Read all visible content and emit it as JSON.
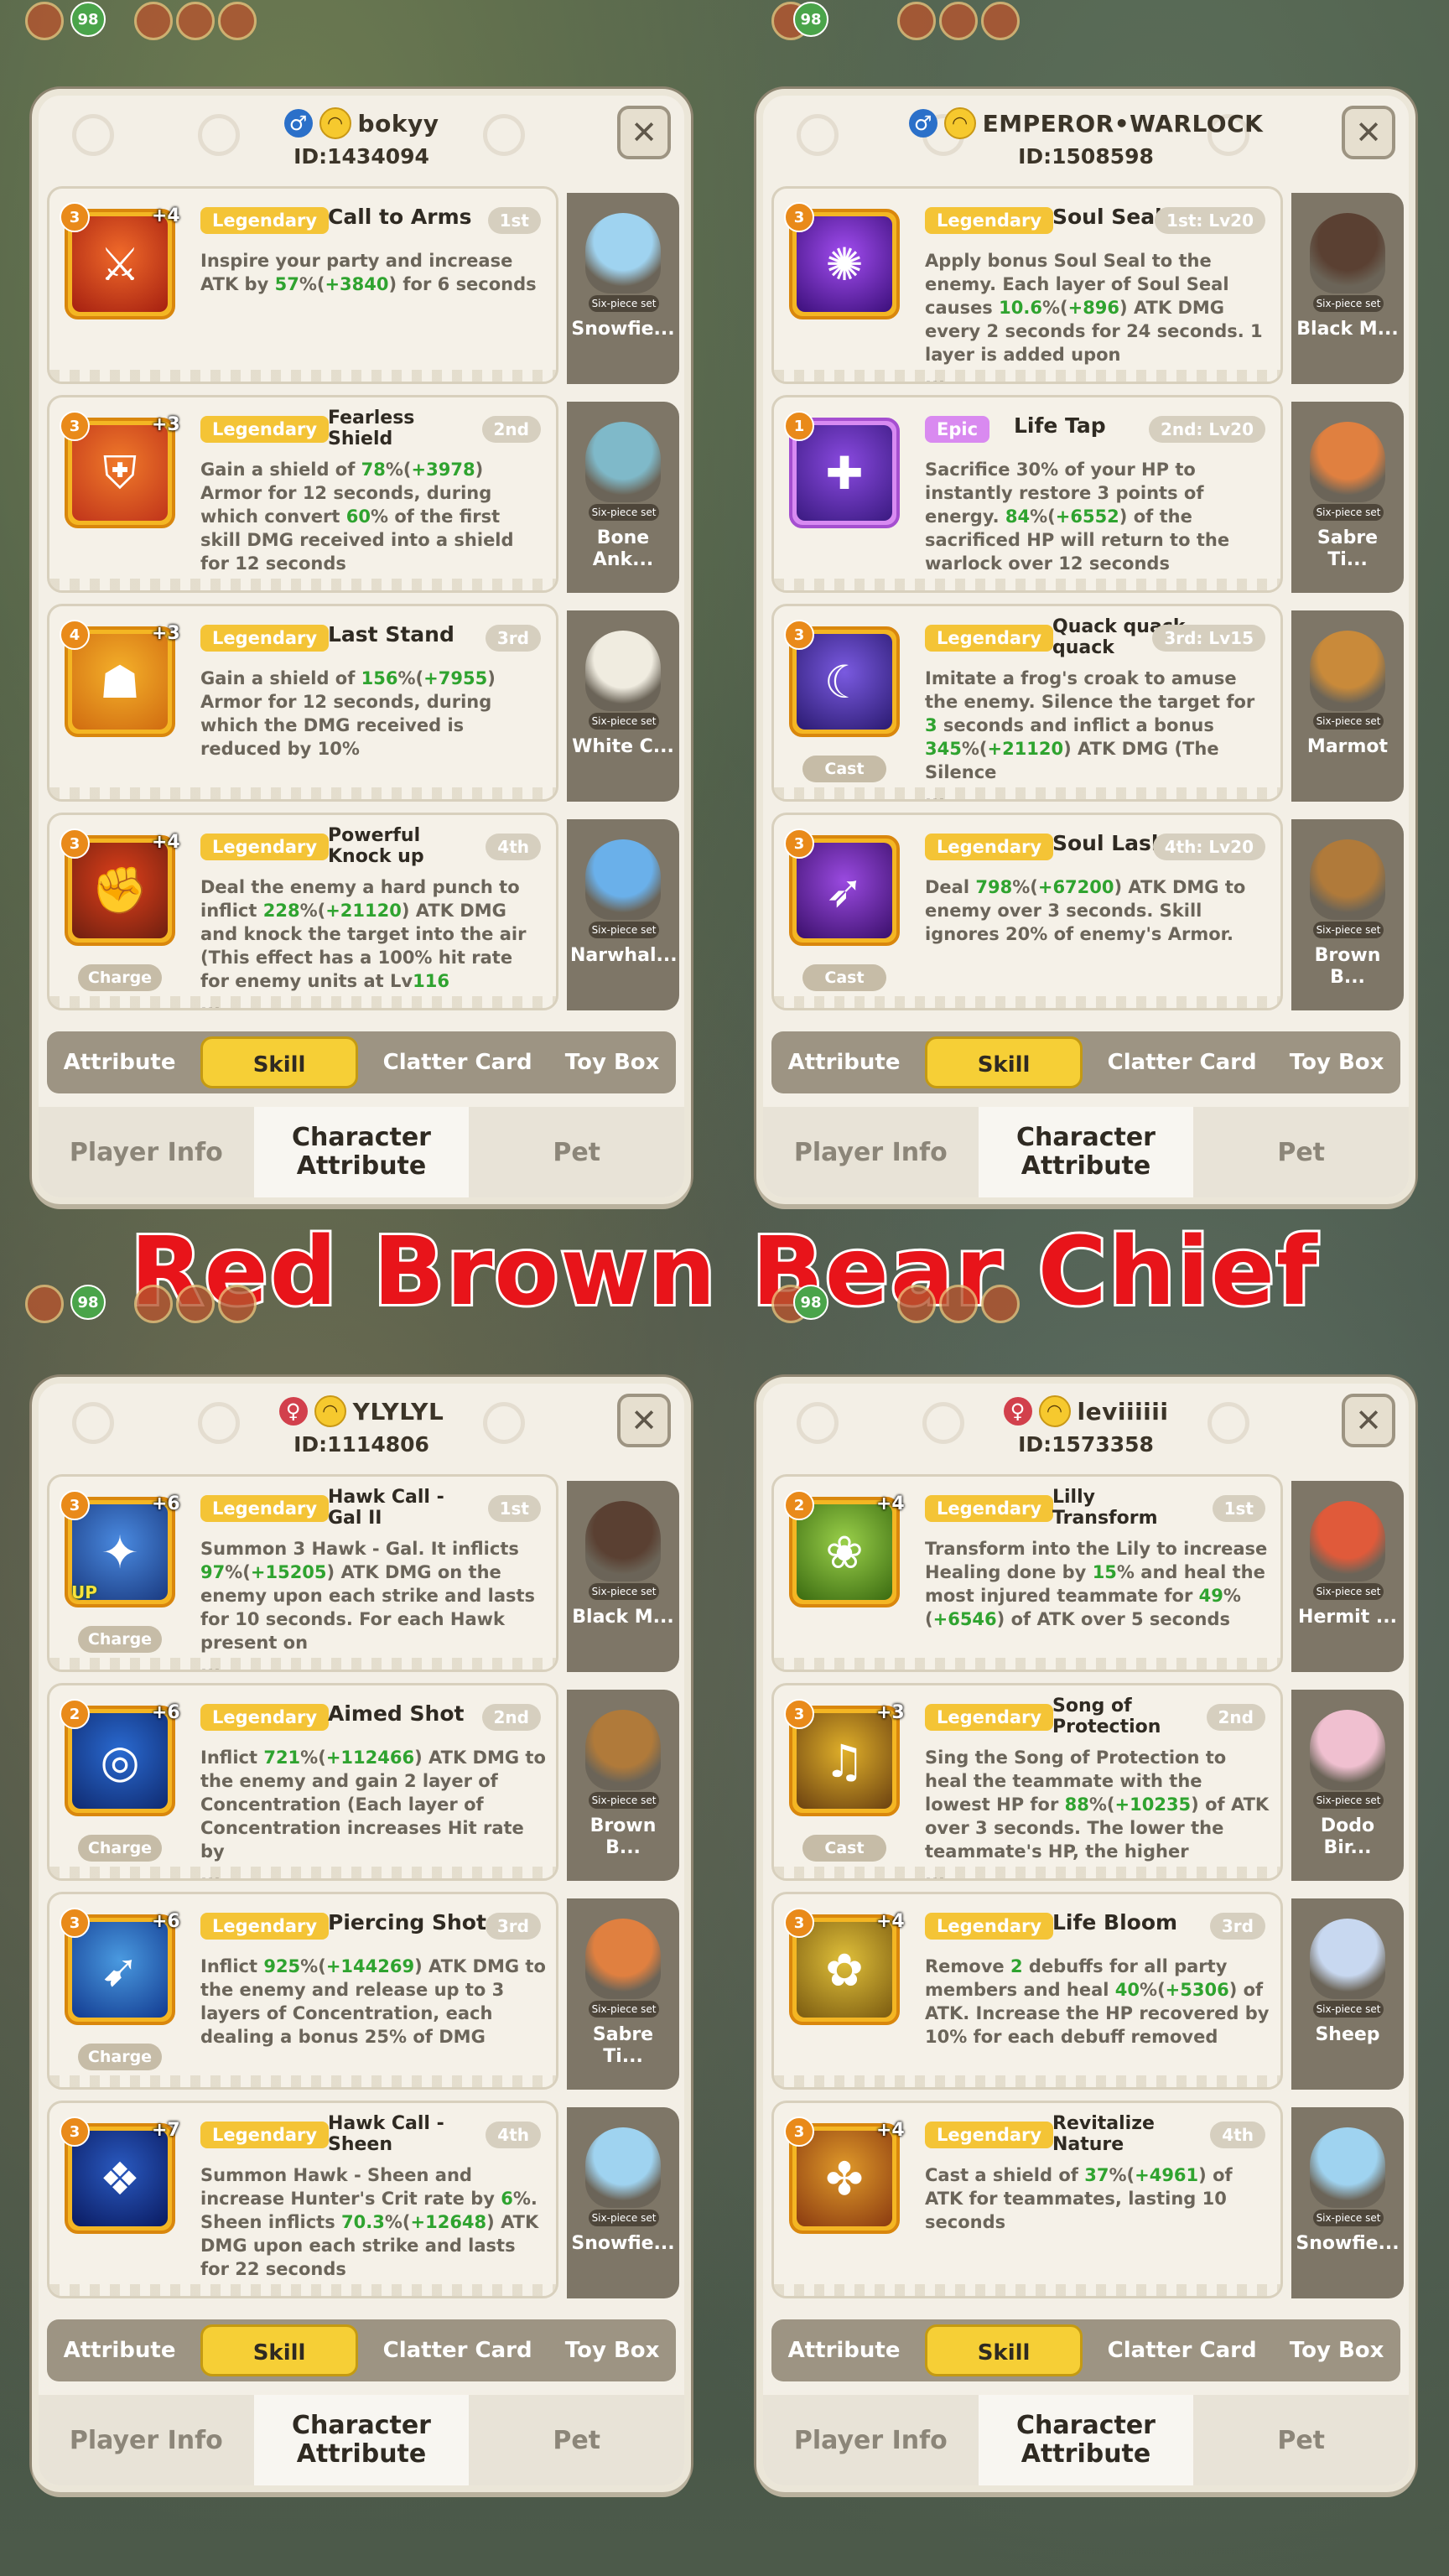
{
  "banner": "Red Brown Bear Chief",
  "hud": {
    "level_badge": "98"
  },
  "panels": [
    {
      "gender": "♂",
      "gender_class": "m",
      "name": "bokyy",
      "id": "ID:1434094",
      "skills": [
        {
          "rarity": "Legendary",
          "name": "Call to Arms",
          "order": "1st",
          "level": "3",
          "plus": "+4",
          "icon": "⚔",
          "colors": [
            "#f06a2a",
            "#a51f10"
          ],
          "desc": [
            [
              "Inspire your party and increase ATK by ",
              ""
            ],
            [
              "57",
              "g"
            ],
            [
              "%(",
              ""
            ],
            [
              "+3840",
              "g"
            ],
            [
              ") for 6 seconds",
              ""
            ]
          ],
          "pet": "Snowfie...",
          "pet_color": "#9fd3f0"
        },
        {
          "rarity": "Legendary",
          "name": "Fearless\nShield",
          "order": "2nd",
          "level": "3",
          "plus": "+3",
          "icon": "⛨",
          "colors": [
            "#f07a2a",
            "#c0341a"
          ],
          "desc": [
            [
              "Gain a shield of ",
              ""
            ],
            [
              "78",
              "g"
            ],
            [
              "%(",
              ""
            ],
            [
              "+3978",
              "g"
            ],
            [
              ") Armor for 12 seconds, during which convert ",
              ""
            ],
            [
              "60",
              "g"
            ],
            [
              "% of the first skill DMG received into a shield for 12 seconds",
              ""
            ]
          ],
          "pet": "Bone\nAnk...",
          "pet_color": "#7fb9c9"
        },
        {
          "rarity": "Legendary",
          "name": "Last Stand",
          "order": "3rd",
          "level": "4",
          "plus": "+3",
          "icon": "☗",
          "colors": [
            "#f4b02a",
            "#d06b10"
          ],
          "desc": [
            [
              "Gain a shield of ",
              ""
            ],
            [
              "156",
              "g"
            ],
            [
              "%(",
              ""
            ],
            [
              "+7955",
              "g"
            ],
            [
              ") Armor for 12 seconds, during which the DMG received is reduced by 10%",
              ""
            ]
          ],
          "pet": "White C...",
          "pet_color": "#f0ece0"
        },
        {
          "rarity": "Legendary",
          "name": "Powerful\nKnock up",
          "order": "4th",
          "level": "3",
          "plus": "+4",
          "icon": "✊",
          "colors": [
            "#e0401a",
            "#6e1f10"
          ],
          "desc": [
            [
              "Deal the enemy a hard punch to inflict ",
              ""
            ],
            [
              "228",
              "g"
            ],
            [
              "%(",
              ""
            ],
            [
              "+21120",
              "g"
            ],
            [
              ") ATK DMG and knock the target into the air (This effect has a 100% hit rate for enemy units at Lv",
              ""
            ],
            [
              "116",
              "g"
            ],
            [
              "\n...",
              ""
            ]
          ],
          "type": "Charge",
          "pet": "Narwhal...",
          "pet_color": "#6ab0ea"
        }
      ]
    },
    {
      "gender": "♂",
      "gender_class": "m",
      "name": "EMPEROR•WARLOCK",
      "id": "ID:1508598",
      "skills": [
        {
          "rarity": "Legendary",
          "name": "Soul Seal",
          "order": "1st: Lv20",
          "level": "3",
          "plus": "",
          "icon": "✺",
          "colors": [
            "#a24df0",
            "#3b0f7a"
          ],
          "desc": [
            [
              "Apply bonus Soul Seal to the enemy. Each layer of Soul Seal causes ",
              ""
            ],
            [
              "10.6",
              "g"
            ],
            [
              "%(",
              ""
            ],
            [
              "+896",
              "g"
            ],
            [
              ") ATK DMG every 2 seconds for 24 seconds. 1 layer is added upon\n...",
              ""
            ]
          ],
          "pet": "Black M...",
          "pet_color": "#5a4032"
        },
        {
          "rarity": "Epic",
          "name": "Life Tap",
          "order": "2nd: Lv20",
          "level": "1",
          "plus": "",
          "icon": "✚",
          "colors": [
            "#8a4ae0",
            "#3a1a80"
          ],
          "epic": true,
          "desc": [
            [
              "Sacrifice 30% of your HP to instantly restore 3 points of energy. ",
              ""
            ],
            [
              "84",
              "g"
            ],
            [
              "%(",
              ""
            ],
            [
              "+6552",
              "g"
            ],
            [
              ") of the sacrificed HP will return to the warlock over 12 seconds",
              ""
            ]
          ],
          "pet": "Sabre Ti...",
          "pet_color": "#e08040"
        },
        {
          "rarity": "Legendary",
          "name": "Quack quack\nquack",
          "order": "3rd: Lv15",
          "level": "3",
          "plus": "",
          "icon": "☾",
          "colors": [
            "#7a5ae0",
            "#2a1a70"
          ],
          "desc": [
            [
              "Imitate a frog's croak to amuse the enemy. Silence the target for ",
              ""
            ],
            [
              "3",
              "g"
            ],
            [
              " seconds and inflict a bonus ",
              ""
            ],
            [
              "345",
              "g"
            ],
            [
              "%(",
              ""
            ],
            [
              "+21120",
              "g"
            ],
            [
              ") ATK DMG (The Silence\n...",
              ""
            ]
          ],
          "type": "Cast",
          "pet": "Marmot",
          "pet_color": "#c98a3a"
        },
        {
          "rarity": "Legendary",
          "name": "Soul Lash",
          "order": "4th: Lv20",
          "level": "3",
          "plus": "",
          "icon": "➶",
          "colors": [
            "#9a4ae0",
            "#3a0f6a"
          ],
          "desc": [
            [
              "Deal ",
              ""
            ],
            [
              "798",
              "g"
            ],
            [
              "%(",
              ""
            ],
            [
              "+67200",
              "g"
            ],
            [
              ") ATK DMG to enemy over 3 seconds. Skill ignores 20% of enemy's Armor.",
              ""
            ]
          ],
          "type": "Cast",
          "pet": "Brown\nB...",
          "pet_color": "#b07a3a"
        }
      ]
    },
    {
      "gender": "♀",
      "gender_class": "f",
      "name": "YLYLYL",
      "id": "ID:1114806",
      "skills": [
        {
          "rarity": "Legendary",
          "name": "Hawk Call -\nGal II",
          "order": "1st",
          "level": "3",
          "plus": "+6",
          "icon": "✦",
          "colors": [
            "#4a8ae0",
            "#1a3a80"
          ],
          "up": "UP",
          "desc": [
            [
              "Summon 3 Hawk - Gal. It inflicts ",
              ""
            ],
            [
              "97",
              "g"
            ],
            [
              "%(",
              ""
            ],
            [
              "+15205",
              "g"
            ],
            [
              ") ATK DMG on the enemy upon each strike and lasts for 10 seconds. For each Hawk present on\n...",
              ""
            ]
          ],
          "type": "Charge",
          "pet": "Black M...",
          "pet_color": "#5a4032"
        },
        {
          "rarity": "Legendary",
          "name": "Aimed Shot",
          "order": "2nd",
          "level": "2",
          "plus": "+6",
          "icon": "◎",
          "colors": [
            "#2a6ad0",
            "#0f2a70"
          ],
          "desc": [
            [
              "Inflict ",
              ""
            ],
            [
              "721",
              "g"
            ],
            [
              "%(",
              ""
            ],
            [
              "+112466",
              "g"
            ],
            [
              ") ATK DMG to the enemy and gain 2 layer of Concentration (Each layer of Concentration increases Hit rate by\n...",
              ""
            ]
          ],
          "type": "Charge",
          "pet": "Brown\nB...",
          "pet_color": "#b07a3a"
        },
        {
          "rarity": "Legendary",
          "name": "Piercing Shot",
          "order": "3rd",
          "level": "3",
          "plus": "+6",
          "icon": "➹",
          "colors": [
            "#4a9ae0",
            "#123a90"
          ],
          "desc": [
            [
              "Inflict ",
              ""
            ],
            [
              "925",
              "g"
            ],
            [
              "%(",
              ""
            ],
            [
              "+144269",
              "g"
            ],
            [
              ") ATK DMG to the enemy and release up to 3 layers of Concentration, each dealing a bonus 25% of DMG",
              ""
            ]
          ],
          "type": "Charge",
          "pet": "Sabre Ti...",
          "pet_color": "#e08040"
        },
        {
          "rarity": "Legendary",
          "name": "Hawk Call -\nSheen",
          "order": "4th",
          "level": "3",
          "plus": "+7",
          "icon": "❖",
          "colors": [
            "#2a5ac0",
            "#0a1a60"
          ],
          "desc": [
            [
              "Summon Hawk - Sheen and increase Hunter's Crit rate by ",
              ""
            ],
            [
              "6",
              "g"
            ],
            [
              "%. Sheen inflicts ",
              ""
            ],
            [
              "70.3",
              "g"
            ],
            [
              "%(",
              ""
            ],
            [
              "+12648",
              "g"
            ],
            [
              ") ATK DMG upon each strike and lasts for 22 seconds",
              ""
            ]
          ],
          "pet": "Snowfie...",
          "pet_color": "#9fd3f0"
        }
      ]
    },
    {
      "gender": "♀",
      "gender_class": "f",
      "name": "leviiiiii",
      "id": "ID:1573358",
      "skills": [
        {
          "rarity": "Legendary",
          "name": "Lilly\nTransform",
          "order": "1st",
          "level": "2",
          "plus": "+4",
          "icon": "❀",
          "colors": [
            "#9ad04a",
            "#3a6a10"
          ],
          "desc": [
            [
              "Transform into the Lily to increase Healing done by ",
              ""
            ],
            [
              "15",
              "g"
            ],
            [
              "% and heal the most injured teammate for ",
              ""
            ],
            [
              "49",
              "g"
            ],
            [
              "%(",
              ""
            ],
            [
              "+6546",
              "g"
            ],
            [
              ") of ATK over 5 seconds",
              ""
            ]
          ],
          "pet": "Hermit ...",
          "pet_color": "#e05a3a"
        },
        {
          "rarity": "Legendary",
          "name": "Song of\nProtection",
          "order": "2nd",
          "level": "3",
          "plus": "+3",
          "icon": "♫",
          "colors": [
            "#e0b02a",
            "#6a4010"
          ],
          "desc": [
            [
              "Sing the Song of Protection to heal the teammate with the lowest HP for ",
              ""
            ],
            [
              "88",
              "g"
            ],
            [
              "%(",
              ""
            ],
            [
              "+10235",
              "g"
            ],
            [
              ") of ATK over 3 seconds. The lower the teammate's HP, the higher\n...",
              ""
            ]
          ],
          "type": "Cast",
          "pet": "Dodo\nBir...",
          "pet_color": "#f0c0d0"
        },
        {
          "rarity": "Legendary",
          "name": "Life Bloom",
          "order": "3rd",
          "level": "3",
          "plus": "+4",
          "icon": "✿",
          "colors": [
            "#e0c03a",
            "#7a5a10"
          ],
          "desc": [
            [
              "Remove ",
              ""
            ],
            [
              "2",
              "g"
            ],
            [
              " debuffs for all party members and heal ",
              ""
            ],
            [
              "40",
              "g"
            ],
            [
              "%(",
              ""
            ],
            [
              "+5306",
              "g"
            ],
            [
              ") of ATK. Increase the HP recovered by 10% for each debuff removed",
              ""
            ]
          ],
          "pet": "Sheep",
          "pet_color": "#c8d8f0"
        },
        {
          "rarity": "Legendary",
          "name": "Revitalize\nNature",
          "order": "4th",
          "level": "3",
          "plus": "+4",
          "icon": "✤",
          "colors": [
            "#e09a2a",
            "#8a3a10"
          ],
          "desc": [
            [
              "Cast a shield of ",
              ""
            ],
            [
              "37",
              "g"
            ],
            [
              "%(",
              ""
            ],
            [
              "+4961",
              "g"
            ],
            [
              ") of ATK for teammates, lasting 10 seconds",
              ""
            ]
          ],
          "pet": "Snowfie...",
          "pet_color": "#9fd3f0"
        }
      ]
    }
  ],
  "tabs": [
    "Attribute",
    "Skill",
    "Clatter Card",
    "Toy Box"
  ],
  "active_tab": "Skill",
  "bottom_tabs": [
    "Player Info",
    "Character\nAttribute",
    "Pet"
  ],
  "active_bottom_tab": "Character\nAttribute",
  "colors": {
    "legendary": "#f4c436",
    "epic": "#d98af0",
    "green_value": "#2fa32f",
    "banner_red": "#e8141a"
  }
}
